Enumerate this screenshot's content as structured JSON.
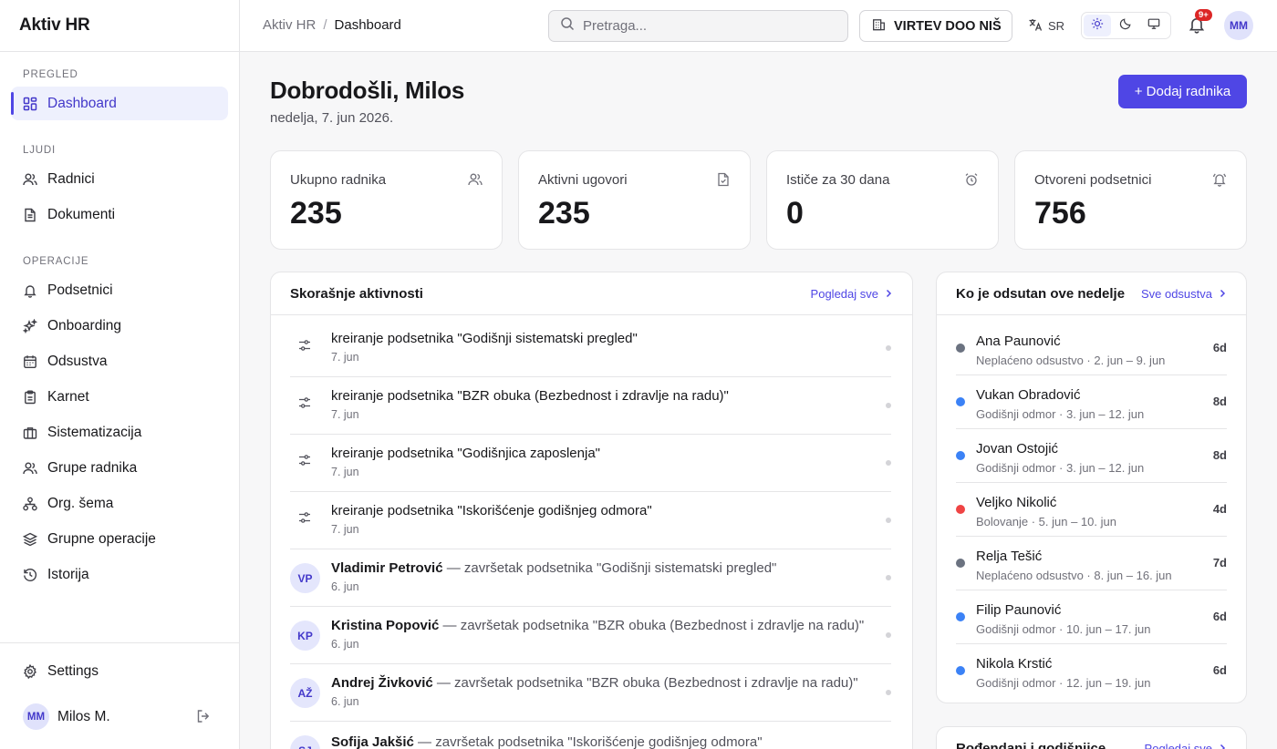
{
  "app": {
    "name": "Aktiv HR"
  },
  "sidebar": {
    "sections": [
      "PREGLED",
      "LJUDI",
      "OPERACIJE"
    ],
    "items": [
      {
        "label": "Dashboard",
        "icon": "dashboard-icon"
      },
      {
        "label": "Radnici",
        "icon": "users-icon"
      },
      {
        "label": "Dokumenti",
        "icon": "document-icon"
      },
      {
        "label": "Podsetnici",
        "icon": "bell-icon"
      },
      {
        "label": "Onboarding",
        "icon": "sparkles-icon"
      },
      {
        "label": "Odsustva",
        "icon": "calendar-icon"
      },
      {
        "label": "Karnet",
        "icon": "clipboard-icon"
      },
      {
        "label": "Sistematizacija",
        "icon": "briefcase-icon"
      },
      {
        "label": "Grupe radnika",
        "icon": "user-group-icon"
      },
      {
        "label": "Org. šema",
        "icon": "org-chart-icon"
      },
      {
        "label": "Grupne operacije",
        "icon": "layers-icon"
      },
      {
        "label": "Istorija",
        "icon": "history-icon"
      }
    ],
    "settings_label": "Settings",
    "user": {
      "initials": "MM",
      "name": "Milos M."
    }
  },
  "header": {
    "breadcrumb": [
      "Aktiv HR",
      "Dashboard"
    ],
    "search_placeholder": "Pretraga...",
    "company": "VIRTEV DOO NIŠ",
    "language": "SR",
    "notification_badge": "9+",
    "user_initials": "MM"
  },
  "main": {
    "greeting": "Dobrodošli, Milos",
    "date": "nedelja, 7. jun 2026.",
    "add_button": "+ Dodaj radnika",
    "stats": [
      {
        "label": "Ukupno radnika",
        "value": "235",
        "icon": "users-icon"
      },
      {
        "label": "Aktivni ugovori",
        "value": "235",
        "icon": "file-check-icon"
      },
      {
        "label": "Ističe za 30 dana",
        "value": "0",
        "icon": "alarm-clock-icon"
      },
      {
        "label": "Otvoreni podsetnici",
        "value": "756",
        "icon": "bell-ring-icon"
      }
    ],
    "activity": {
      "title": "Skorašnje aktivnosti",
      "link": "Pogledaj sve",
      "items": [
        {
          "type": "system",
          "text": "kreiranje podsetnika \"Godišnji sistematski pregled\"",
          "date": "7. jun"
        },
        {
          "type": "system",
          "text": "kreiranje podsetnika \"BZR obuka (Bezbednost i zdravlje na radu)\"",
          "date": "7. jun"
        },
        {
          "type": "system",
          "text": "kreiranje podsetnika \"Godišnjica zaposlenja\"",
          "date": "7. jun"
        },
        {
          "type": "system",
          "text": "kreiranje podsetnika \"Iskorišćenje godišnjeg odmora\"",
          "date": "7. jun"
        },
        {
          "type": "user",
          "initials": "VP",
          "name": "Vladimir Petrović",
          "text": " — završetak podsetnika \"Godišnji sistematski pregled\"",
          "date": "6. jun"
        },
        {
          "type": "user",
          "initials": "KP",
          "name": "Kristina Popović",
          "text": " — završetak podsetnika \"BZR obuka (Bezbednost i zdravlje na radu)\"",
          "date": "6. jun"
        },
        {
          "type": "user",
          "initials": "AŽ",
          "name": "Andrej Živković",
          "text": " — završetak podsetnika \"BZR obuka (Bezbednost i zdravlje na radu)\"",
          "date": "6. jun"
        },
        {
          "type": "user",
          "initials": "SJ",
          "name": "Sofija Jakšić",
          "text": " — završetak podsetnika \"Iskorišćenje godišnjeg odmora\"",
          "date": ""
        }
      ]
    },
    "absence": {
      "title": "Ko je odsutan ove nedelje",
      "link": "Sve odsustva",
      "items": [
        {
          "name": "Ana Paunović",
          "detail": "Neplaćeno odsustvo · 2. jun – 9. jun",
          "days": "6d",
          "color": "#6b7280"
        },
        {
          "name": "Vukan Obradović",
          "detail": "Godišnji odmor · 3. jun – 12. jun",
          "days": "8d",
          "color": "#3b82f6"
        },
        {
          "name": "Jovan Ostojić",
          "detail": "Godišnji odmor · 3. jun – 12. jun",
          "days": "8d",
          "color": "#3b82f6"
        },
        {
          "name": "Veljko Nikolić",
          "detail": "Bolovanje · 5. jun – 10. jun",
          "days": "4d",
          "color": "#ef4444"
        },
        {
          "name": "Relja Tešić",
          "detail": "Neplaćeno odsustvo · 8. jun – 16. jun",
          "days": "7d",
          "color": "#6b7280"
        },
        {
          "name": "Filip Paunović",
          "detail": "Godišnji odmor · 10. jun – 17. jun",
          "days": "6d",
          "color": "#3b82f6"
        },
        {
          "name": "Nikola Krstić",
          "detail": "Godišnji odmor · 12. jun – 19. jun",
          "days": "6d",
          "color": "#3b82f6"
        }
      ]
    },
    "birthdays": {
      "title": "Rođendani i godišnjice",
      "link": "Pogledaj sve"
    }
  },
  "colors": {
    "accent": "#4f46e5",
    "badge": "#dc2626"
  }
}
